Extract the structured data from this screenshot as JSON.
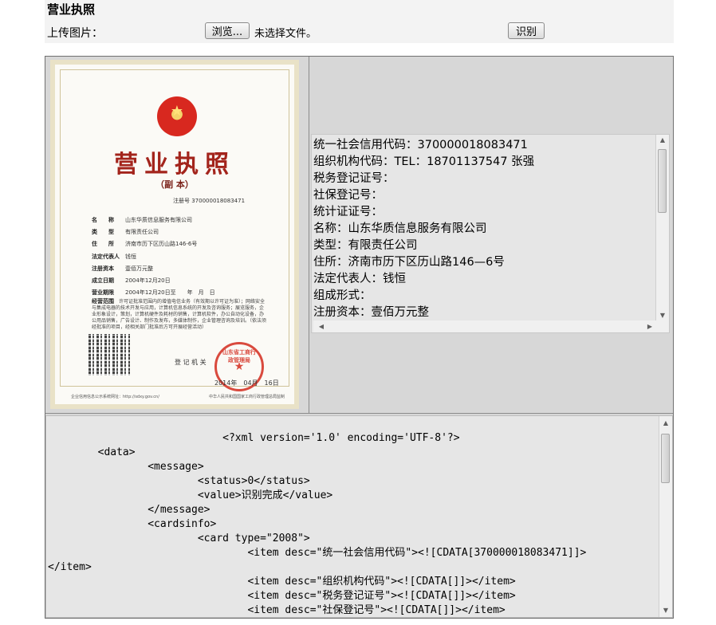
{
  "header": {
    "title": "营业执照",
    "upload_label": "上传图片：",
    "browse_label": "浏览...",
    "no_file_label": "未选择文件。",
    "recognize_label": "识别"
  },
  "license_image": {
    "title": "营业执照",
    "subtitle": "（副 本）",
    "reg_no": "注册号 370000018083471",
    "rows": [
      {
        "k": "名　　称",
        "v": "山东华质信息服务有限公司"
      },
      {
        "k": "类　　型",
        "v": "有限责任公司"
      },
      {
        "k": "住　　所",
        "v": "济南市历下区历山路146-6号"
      },
      {
        "k": "法定代表人",
        "v": "钱恒"
      },
      {
        "k": "注册资本",
        "v": "壹佰万元整"
      },
      {
        "k": "成立日期",
        "v": "2004年12月20日"
      },
      {
        "k": "营业期限",
        "v": "2004年12月20日至　　年　月　日"
      }
    ],
    "scope_key": "经营范围",
    "scope_text": "许可证批准范围内的增值电信业务（有效期以许可证为准）；网络安全与集成电器的技术开发与应用，计算机信息系统的开发及咨询服务；展览服务，企业形象设计，策划，计算机硬件及耗材的销售，计算机软件，办公自动化设备，办公用品销售，广告设计、制作及发布，多媒体制作，企业管理咨询及培训。（依法须经批准的项目，经相关部门批准后方可开展经营活动）",
    "issuer": "登 记 机 关",
    "issue_date": "2014年　04月　16日",
    "stamp_text": "山东省工商行政管理局",
    "footer_left": "企业信用信息公示系统网址：http://sdxy.gov.cn/",
    "footer_right": "中华人民共和国国家工商行政管理总局监制"
  },
  "info": {
    "lines": [
      "统一社会信用代码：370000018083471",
      "组织机构代码：TEL：18701137547 张强",
      "税务登记证号：",
      "社保登记号：",
      "统计证证号：",
      "名称：山东华质信息服务有限公司",
      "类型：有限责任公司",
      "住所：济南市历下区历山路146—6号",
      "法定代表人：钱恒",
      "组成形式：",
      "注册资本：壹佰万元整"
    ]
  },
  "xml": {
    "lines": [
      "                            <?xml version='1.0' encoding='UTF-8'?>",
      "        <data>",
      "                <message>",
      "                        <status>0</status>",
      "                        <value>识别完成</value>",
      "                </message>",
      "                <cardsinfo>",
      "                        <card type=\"2008\">",
      "                                <item desc=\"统一社会信用代码\"><![CDATA[370000018083471]]>",
      "</item>",
      "                                <item desc=\"组织机构代码\"><![CDATA[]]></item>",
      "                                <item desc=\"税务登记证号\"><![CDATA[]]></item>",
      "                                <item desc=\"社保登记号\"><![CDATA[]]></item>"
    ]
  },
  "colors": {
    "panel_bg": "#d7d7d7",
    "text_bg": "#e6e6e6",
    "license_red": "#a3241c",
    "stamp_red": "#d94a3e"
  }
}
